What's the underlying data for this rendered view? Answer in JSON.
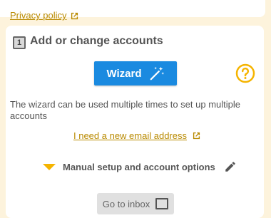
{
  "top": {
    "privacy_label": "Privacy policy"
  },
  "section": {
    "step_number": "1",
    "title": "Add or change accounts",
    "wizard_label": "Wizard",
    "description": "The wizard can be used multiple times to set up multiple accounts",
    "new_email_label": "I need a new email address",
    "manual_label": "Manual setup and account options",
    "inbox_label": "Go to inbox"
  },
  "colors": {
    "background": "#fdf3dc",
    "accent_link": "#b98a00",
    "wizard_button": "#1a8ae0",
    "help_icon": "#f5b400"
  },
  "icons": [
    "external-link-icon",
    "magic-wand-icon",
    "help-icon",
    "triangle-down-icon",
    "pencil-icon",
    "inbox-icon"
  ]
}
